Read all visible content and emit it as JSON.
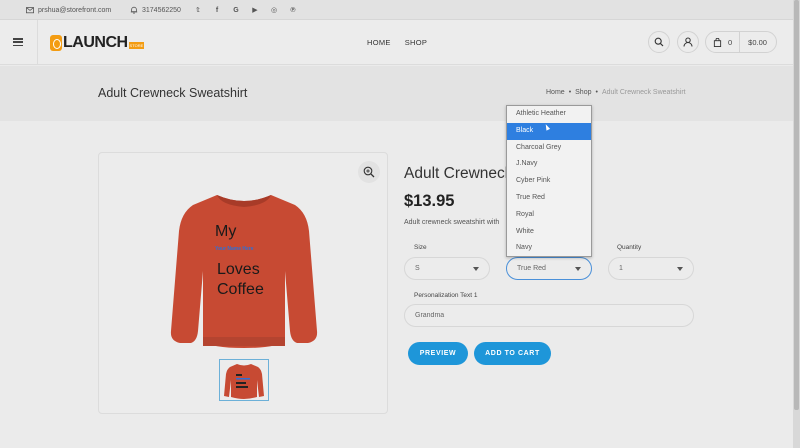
{
  "topbar": {
    "email": "prshua@storefront.com",
    "phone": "3174562250",
    "socials": [
      "twitter-icon",
      "facebook-icon",
      "google-icon",
      "youtube-icon",
      "instagram-icon",
      "pinterest-icon"
    ],
    "social_glyphs": [
      "𝕥",
      "f",
      "G",
      "▶",
      "◎",
      "℗"
    ]
  },
  "header": {
    "logo_text": "LAUNCH",
    "logo_tag": "STORE",
    "nav": [
      "HOME",
      "SHOP"
    ],
    "cart_count": "0",
    "cart_total": "$0.00"
  },
  "band": {
    "title": "Adult Crewneck Sweatshirt",
    "breadcrumb": [
      "Home",
      "•",
      "Shop",
      "•",
      "Adult Crewneck Sweatshirt"
    ]
  },
  "product": {
    "name": "Adult Crewneck Sweatshirt",
    "price": "$13.95",
    "description": "Adult crewneck sweatshirt with",
    "shirt_text": [
      "My",
      "Your Name Here",
      "Loves",
      "Coffee"
    ],
    "size_label": "Size",
    "size_value": "S",
    "color_value": "True Red",
    "quantity_label": "Quantity",
    "quantity_value": "1",
    "personalization_label": "Personalization Text 1",
    "personalization_value": "Grandma",
    "preview_label": "PREVIEW",
    "add_to_cart_label": "ADD TO CART"
  },
  "color_options": [
    "Athletic Heather",
    "Black",
    "Charcoal Grey",
    "J.Navy",
    "Cyber Pink",
    "True Red",
    "Royal",
    "White",
    "Navy"
  ],
  "highlighted_option_index": 1,
  "colors": {
    "accent": "#1e96d9",
    "highlight": "#2e7fe0",
    "shirt": "#c74a33"
  }
}
